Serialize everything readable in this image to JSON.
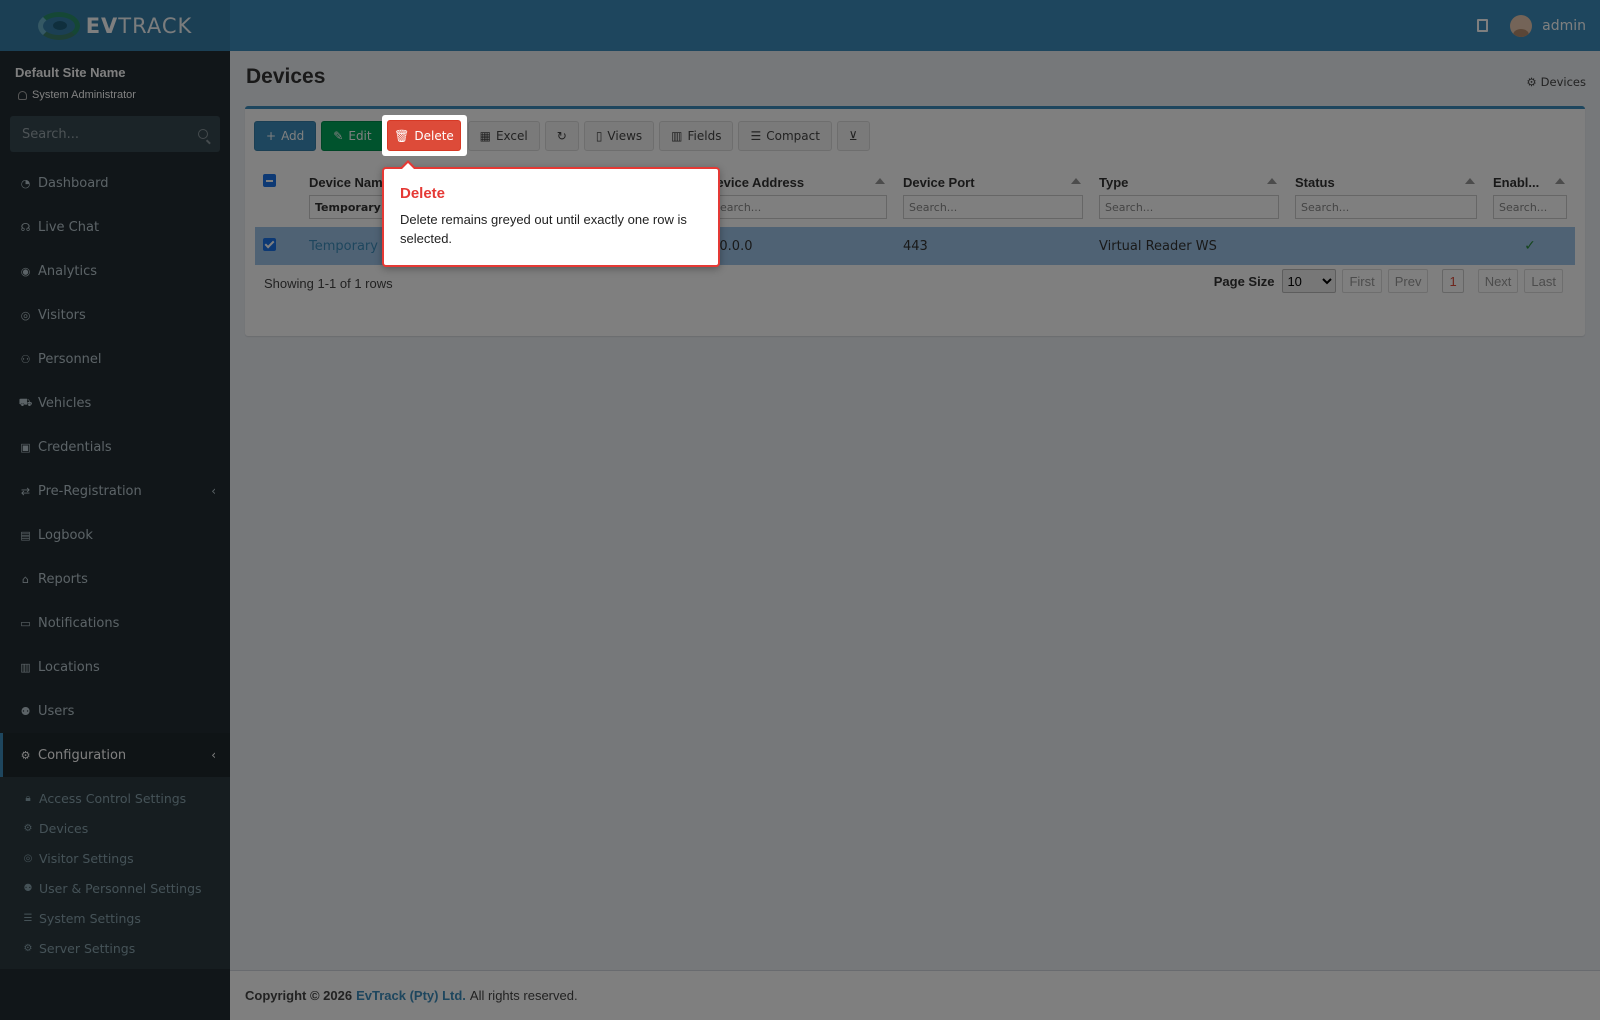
{
  "header": {
    "logo_bold": "EV",
    "logo_rest": "TRACK",
    "user": "admin"
  },
  "sidebar": {
    "site_name": "Default Site Name",
    "role": "System Administrator",
    "search_placeholder": "Search...",
    "items": [
      {
        "label": "Dashboard",
        "icon": "dashboard-icon",
        "glyph": "◔"
      },
      {
        "label": "Live Chat",
        "icon": "headset-icon",
        "glyph": "☊"
      },
      {
        "label": "Analytics",
        "icon": "target-icon",
        "glyph": "◉"
      },
      {
        "label": "Visitors",
        "icon": "eye-icon",
        "glyph": "◎"
      },
      {
        "label": "Personnel",
        "icon": "users-icon",
        "glyph": "⚇"
      },
      {
        "label": "Vehicles",
        "icon": "car-icon",
        "glyph": "⛟"
      },
      {
        "label": "Credentials",
        "icon": "id-card-icon",
        "glyph": "▣"
      },
      {
        "label": "Pre-Registration",
        "icon": "exchange-icon",
        "glyph": "⇄"
      },
      {
        "label": "Logbook",
        "icon": "book-icon",
        "glyph": "▤"
      },
      {
        "label": "Reports",
        "icon": "chart-icon",
        "glyph": "⌂"
      },
      {
        "label": "Notifications",
        "icon": "bell-icon",
        "glyph": "▭"
      },
      {
        "label": "Locations",
        "icon": "building-icon",
        "glyph": "▥"
      },
      {
        "label": "Users",
        "icon": "user-cog-icon",
        "glyph": "⚉"
      },
      {
        "label": "Configuration",
        "icon": "cogs-icon",
        "glyph": "⚙"
      }
    ],
    "submenu": [
      {
        "label": "Access Control Settings",
        "icon": "lock-icon",
        "glyph": "🔒︎"
      },
      {
        "label": "Devices",
        "icon": "cog-icon",
        "glyph": "⚙"
      },
      {
        "label": "Visitor Settings",
        "icon": "eye-icon",
        "glyph": "◎"
      },
      {
        "label": "User & Personnel Settings",
        "icon": "user-cog-icon",
        "glyph": "⚉"
      },
      {
        "label": "System Settings",
        "icon": "sliders-icon",
        "glyph": "☰"
      },
      {
        "label": "Server Settings",
        "icon": "server-cog-icon",
        "glyph": "⚙"
      }
    ]
  },
  "page": {
    "title": "Devices",
    "breadcrumb": "Devices"
  },
  "toolbar": {
    "add": "Add",
    "edit": "Edit",
    "delete": "Delete",
    "excel": "Excel",
    "views": "Views",
    "fields": "Fields",
    "compact": "Compact"
  },
  "table": {
    "columns": [
      "Device Name",
      "Device Address",
      "Device Port",
      "Type",
      "Status",
      "Enabl..."
    ],
    "filter_placeholder": "Search...",
    "name_filter_value": "Temporary Device",
    "row": {
      "name": "Temporary Device",
      "address": "0.0.0.0",
      "port": "443",
      "type": "Virtual Reader WS",
      "status": "",
      "enabled": "✓"
    },
    "showing": "Showing 1-1 of 1 rows"
  },
  "pager": {
    "page_size_label": "Page Size",
    "page_size": "10",
    "first": "First",
    "prev": "Prev",
    "current": "1",
    "next": "Next",
    "last": "Last"
  },
  "footer": {
    "copyright": "Copyright © 2026",
    "company": "EvTrack (Pty) Ltd.",
    "rights": "All rights reserved."
  },
  "tour": {
    "title": "Delete",
    "body": "Delete remains greyed out until exactly one row is selected."
  }
}
